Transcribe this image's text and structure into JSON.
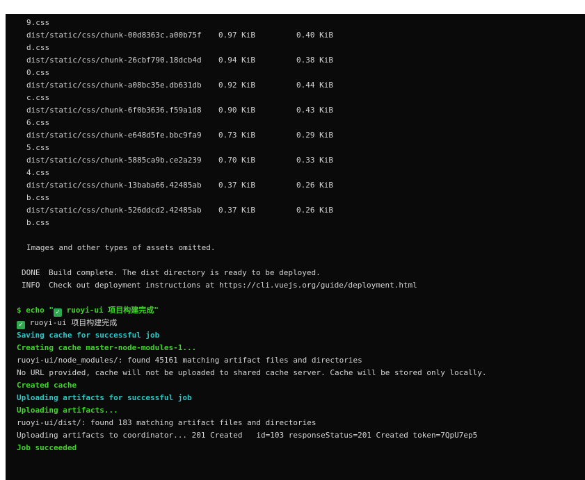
{
  "assets": [
    {
      "cont": "9.css"
    },
    {
      "file": "dist/static/css/chunk-00d8363c.a00b75f",
      "size": "0.97 KiB",
      "gzipped": "0.40 KiB",
      "cont": "d.css"
    },
    {
      "file": "dist/static/css/chunk-26cbf790.18dcb4d",
      "size": "0.94 KiB",
      "gzipped": "0.38 KiB",
      "cont": "0.css"
    },
    {
      "file": "dist/static/css/chunk-a08bc35e.db631db",
      "size": "0.92 KiB",
      "gzipped": "0.44 KiB",
      "cont": "c.css"
    },
    {
      "file": "dist/static/css/chunk-6f0b3636.f59a1d8",
      "size": "0.90 KiB",
      "gzipped": "0.43 KiB",
      "cont": "6.css"
    },
    {
      "file": "dist/static/css/chunk-e648d5fe.bbc9fa9",
      "size": "0.73 KiB",
      "gzipped": "0.29 KiB",
      "cont": "5.css"
    },
    {
      "file": "dist/static/css/chunk-5885ca9b.ce2a239",
      "size": "0.70 KiB",
      "gzipped": "0.33 KiB",
      "cont": "4.css"
    },
    {
      "file": "dist/static/css/chunk-13baba66.42485ab",
      "size": "0.37 KiB",
      "gzipped": "0.26 KiB",
      "cont": "b.css"
    },
    {
      "file": "dist/static/css/chunk-526ddcd2.42485ab",
      "size": "0.37 KiB",
      "gzipped": "0.26 KiB",
      "cont": "b.css"
    }
  ],
  "omitted_note": "Images and other types of assets omitted.",
  "done_tag": "DONE",
  "done_text": "Build complete. The dist directory is ready to be deployed.",
  "info_tag": "INFO",
  "info_text": "Check out deployment instructions at https://cli.vuejs.org/guide/deployment.html",
  "echo_cmd_prefix": "$ echo \"",
  "echo_cmd_text": " ruoyi-ui 项目构建完成\"",
  "echo_out_text": " ruoyi-ui 项目构建完成",
  "check_glyph": "✓",
  "log": {
    "saving_cache": "Saving cache for successful job",
    "creating_cache": "Creating cache master-node-modules-1...",
    "node_modules_found": "ruoyi-ui/node_modules/: found 45161 matching artifact files and directories",
    "no_url": "No URL provided, cache will not be uploaded to shared cache server. Cache will be stored only locally.",
    "created_cache": "Created cache",
    "uploading_success": "Uploading artifacts for successful job",
    "uploading": "Uploading artifacts...",
    "dist_found": "ruoyi-ui/dist/: found 183 matching artifact files and directories",
    "coordinator": "Uploading artifacts to coordinator... 201 Created   id=103 responseStatus=201 Created token=7QpU7ep5",
    "job_succeeded": "Job succeeded"
  },
  "colors": {
    "background": "#0a0a0a",
    "text": "#d4d4d4",
    "cyan": "#2ec5c5",
    "green": "#43d12e",
    "check": "#2fa84f"
  }
}
